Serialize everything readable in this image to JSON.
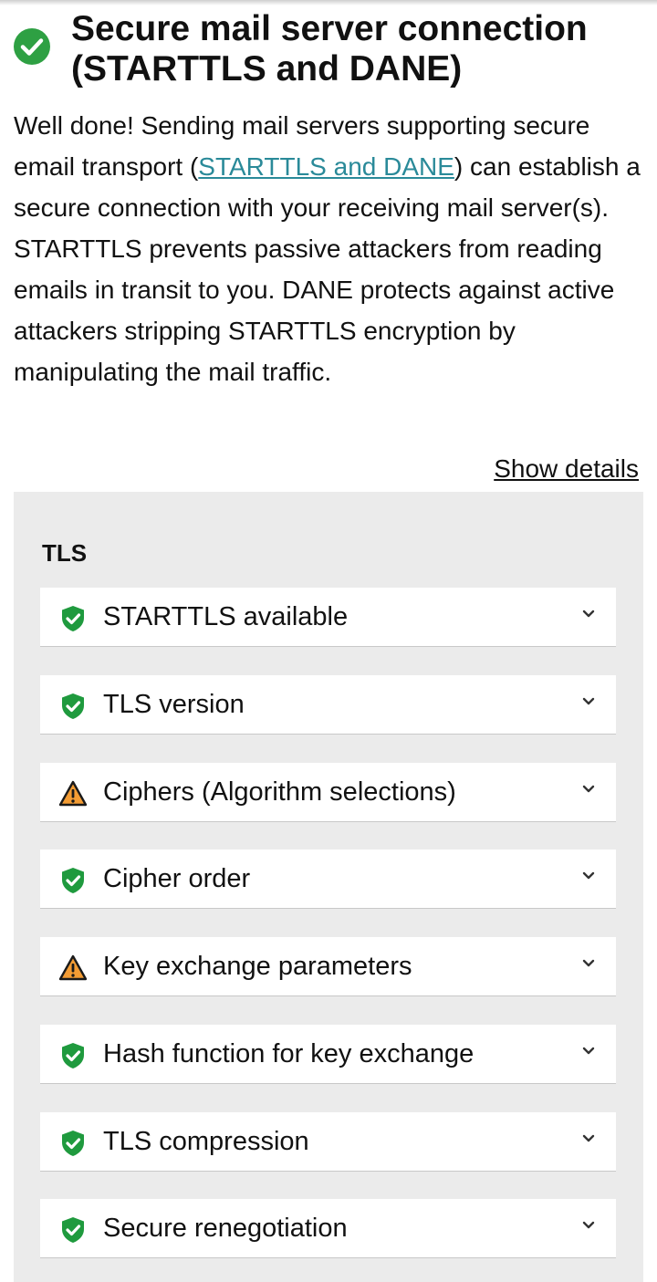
{
  "header": {
    "title": "Secure mail server connection (STARTTLS and DANE)",
    "status_icon": "check-circle-icon",
    "status_color": "#2ea043"
  },
  "intro": {
    "part1": "Well done! Sending mail servers supporting secure email transport (",
    "link_text": "STARTTLS and DANE",
    "part2": ") can establish a secure connection with your receiving mail server(s). STARTTLS prevents passive attackers from reading emails in transit to you. DANE protects against active attackers stripping STARTTLS encryption by manipulating the mail traffic.",
    "link_color": "#2a8a99"
  },
  "show_details": "Show details",
  "panel": {
    "title": "TLS",
    "background": "#ebebeb",
    "items": [
      {
        "label": "STARTTLS available",
        "status": "pass",
        "icon": "shield-check-icon"
      },
      {
        "label": "TLS version",
        "status": "pass",
        "icon": "shield-check-icon"
      },
      {
        "label": "Ciphers (Algorithm selections)",
        "status": "warning",
        "icon": "warning-triangle-icon"
      },
      {
        "label": "Cipher order",
        "status": "pass",
        "icon": "shield-check-icon"
      },
      {
        "label": "Key exchange parameters",
        "status": "warning",
        "icon": "warning-triangle-icon"
      },
      {
        "label": "Hash function for key exchange",
        "status": "pass",
        "icon": "shield-check-icon"
      },
      {
        "label": "TLS compression",
        "status": "pass",
        "icon": "shield-check-icon"
      },
      {
        "label": "Secure renegotiation",
        "status": "pass",
        "icon": "shield-check-icon"
      }
    ]
  },
  "colors": {
    "pass": "#1f9a3e",
    "warning": "#f39c34"
  }
}
